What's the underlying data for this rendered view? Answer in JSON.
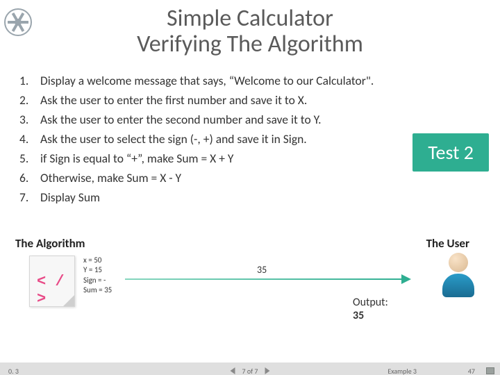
{
  "title_line1": "Simple Calculator",
  "title_line2": "Verifying The Algorithm",
  "steps": [
    {
      "n": "1.",
      "t": "Display a welcome message that says, “Welcome to our Calculator\"."
    },
    {
      "n": "2.",
      "t": "Ask the user to enter the first number and save it to X."
    },
    {
      "n": "3.",
      "t": "Ask the user to enter the second number and save it to Y."
    },
    {
      "n": "4.",
      "t": "Ask the user to select the sign (-, +) and save it in Sign."
    },
    {
      "n": "5.",
      "t": "if Sign is equal to “+”, make Sum = X + Y"
    },
    {
      "n": "6.",
      "t": "Otherwise, make Sum = X - Y"
    },
    {
      "n": "7.",
      "t": "Display Sum"
    }
  ],
  "test_badge": "Test 2",
  "labels": {
    "algorithm": "The Algorithm",
    "user": "The User"
  },
  "vars": {
    "x": "x = 50",
    "y": "Y = 15",
    "sign": "Sign = -",
    "sum": "Sum = 35"
  },
  "arrow_value": "35",
  "output": {
    "label": "Output:",
    "value": "35"
  },
  "footer": {
    "version": "0. 3",
    "nav": "7 of 7",
    "example": "Example 3",
    "page": "47"
  },
  "code_symbol": "< / >"
}
